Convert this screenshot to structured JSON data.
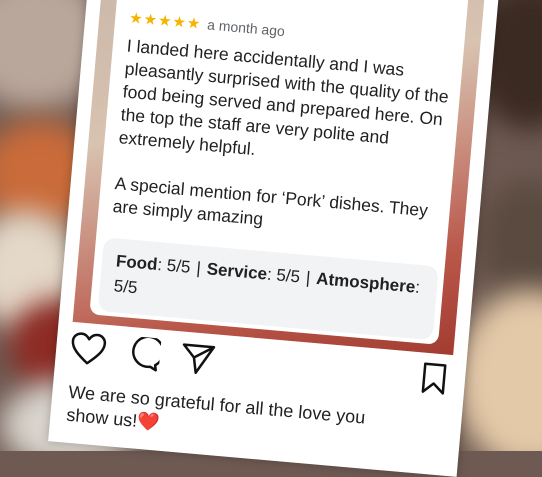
{
  "review": {
    "time": "a month ago",
    "text1": "I landed here accidentally and I was pleasantly surprised with the quality of the food being served and prepared here. On the top the staff are very polite and extremely helpful.",
    "text2": "A special mention for ‘Pork’ dishes. They are simply amazing",
    "ratings": {
      "food_label": "Food",
      "food_value": ": 5/5",
      "service_label": "Service",
      "service_value": ": 5/5",
      "atmosphere_label": "Atmosphere",
      "atmosphere_value": ": 5/5",
      "separator": "|"
    }
  },
  "post": {
    "caption": "We are so grateful for all the love you show us!❤️"
  }
}
